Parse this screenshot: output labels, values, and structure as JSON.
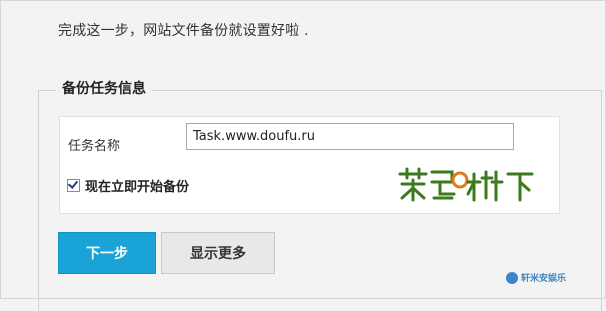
{
  "intro_text": "完成这一步，网站文件备份就设置好啦 .",
  "section_legend": "备份任务信息",
  "task_name": {
    "label": "任务名称",
    "value": "Task.www.doufu.ru"
  },
  "start_now": {
    "label": "现在立即开始备份",
    "checked": true
  },
  "logo": {
    "text": "菜鸟树下",
    "color": "#3c7a1e"
  },
  "buttons": {
    "next": "下一步",
    "more": "显示更多"
  },
  "watermark": {
    "text": "轩米安娱乐"
  },
  "colors": {
    "primary_button": "#1aa3d6",
    "background": "#f3f3f3"
  }
}
